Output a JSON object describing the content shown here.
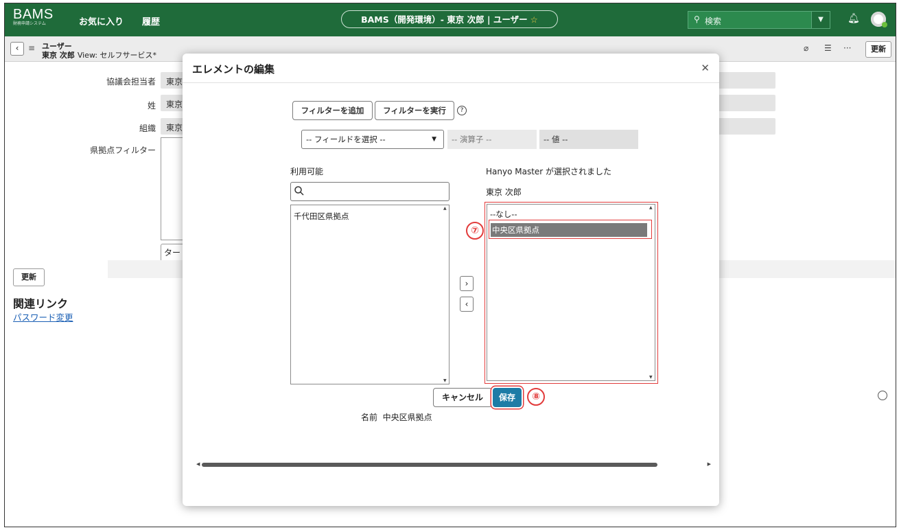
{
  "topbar": {
    "brand": "BAMS",
    "brand_sub": "財務申請システム",
    "nav": [
      "お気に入り",
      "履歴"
    ],
    "page_title": "BAMS（開発環境）- 東京 次郎 | ユーザー",
    "search_placeholder": "検索",
    "colors": {
      "bar": "#1f6b3a",
      "accent": "#1d7ca6",
      "highlight": "#e23b3b"
    }
  },
  "subbar": {
    "record_type": "ユーザー",
    "record_name": "東京 次郎",
    "view_label": "View: セルフサービス*",
    "update_label": "更新"
  },
  "form": {
    "fields": [
      {
        "label": "協議会担当者",
        "value": "東京"
      },
      {
        "label": "姓",
        "value": "東京"
      },
      {
        "label": "組織",
        "value": "東京"
      },
      {
        "label": "県拠点フィルター",
        "value": ""
      }
    ],
    "small_input_text": "ター",
    "update_label": "更新",
    "related_links_heading": "関連リンク",
    "related_links": [
      "パスワード変更"
    ]
  },
  "modal": {
    "title": "エレメントの編集",
    "add_filter_label": "フィルターを追加",
    "run_filter_label": "フィルターを実行",
    "field_select": "-- フィールドを選択 --",
    "operator_placeholder": "-- 演算子 --",
    "value_placeholder": "-- 値 --",
    "available_label": "利用可能",
    "selected_label": "Hanyo Master が選択されました",
    "selected_user": "東京 次郎",
    "available_items": [
      "千代田区県拠点"
    ],
    "selected_items": [
      "--なし--",
      "中央区県拠点"
    ],
    "cancel_label": "キャンセル",
    "save_label": "保存",
    "name_label": "名前",
    "name_value": "中央区県拠点",
    "step_markers": [
      "⑦",
      "⑧"
    ]
  }
}
